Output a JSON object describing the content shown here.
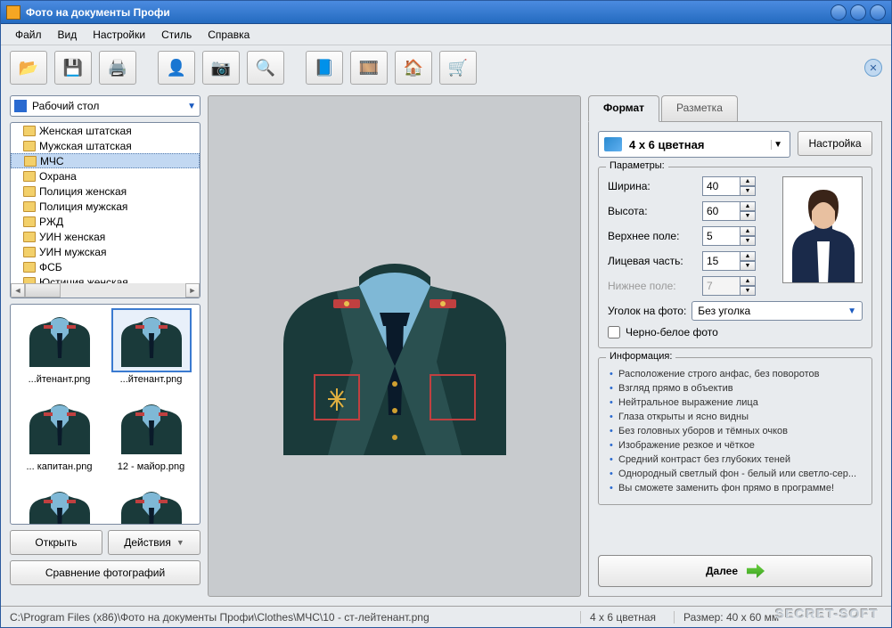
{
  "titlebar": {
    "title": "Фото на документы Профи"
  },
  "menus": [
    "Файл",
    "Вид",
    "Настройки",
    "Стиль",
    "Справка"
  ],
  "toolbar_icons": [
    "folder-open-icon",
    "save-icon",
    "print-icon",
    "person-search-icon",
    "camera-icon",
    "photo-zoom-icon",
    "help-book-icon",
    "film-icon",
    "home-icon",
    "cart-icon"
  ],
  "left": {
    "combo": "Рабочий стол",
    "folders": [
      "Женская штатская",
      "Мужская штатская",
      "МЧС",
      "Охрана",
      "Полиция женская",
      "Полиция мужская",
      "РЖД",
      "УИН женская",
      "УИН мужская",
      "ФСБ",
      "Юстиция женская"
    ],
    "selected_folder": "МЧС",
    "thumbs": [
      "...йтенант.png",
      "...йтенант.png",
      "... капитан.png",
      "12 - майор.png",
      "",
      ""
    ],
    "selected_thumb": 1,
    "open_btn": "Открыть",
    "actions_btn": "Действия",
    "compare_btn": "Сравнение фотографий"
  },
  "tabs": {
    "format": "Формат",
    "layout": "Разметка"
  },
  "format": {
    "combo": "4 x 6 цветная",
    "settings_btn": "Настройка",
    "params_legend": "Параметры:",
    "fields": {
      "width": {
        "label": "Ширина:",
        "value": "40"
      },
      "height": {
        "label": "Высота:",
        "value": "60"
      },
      "top": {
        "label": "Верхнее поле:",
        "value": "5"
      },
      "face": {
        "label": "Лицевая часть:",
        "value": "15"
      },
      "bottom": {
        "label": "Нижнее поле:",
        "value": "7"
      }
    },
    "corner": {
      "label": "Уголок на фото:",
      "value": "Без уголка"
    },
    "bw": "Черно-белое фото",
    "info_legend": "Информация:",
    "info": [
      "Расположение строго анфас, без поворотов",
      "Взгляд прямо в объектив",
      "Нейтральное выражение лица",
      "Глаза открыты и ясно видны",
      "Без головных уборов и тёмных очков",
      "Изображение резкое и чёткое",
      "Средний контраст без глубоких теней",
      "Однородный светлый фон - белый или светло-сер...",
      "Вы сможете заменить фон прямо в программе!"
    ],
    "next": "Далее"
  },
  "statusbar": {
    "path": "C:\\Program Files (x86)\\Фото на документы Профи\\Clothes\\МЧС\\10 - ст-лейтенант.png",
    "format": "4 x 6 цветная",
    "size": "Размер: 40 x 60 мм"
  },
  "watermark": "SECRET-SOFT"
}
